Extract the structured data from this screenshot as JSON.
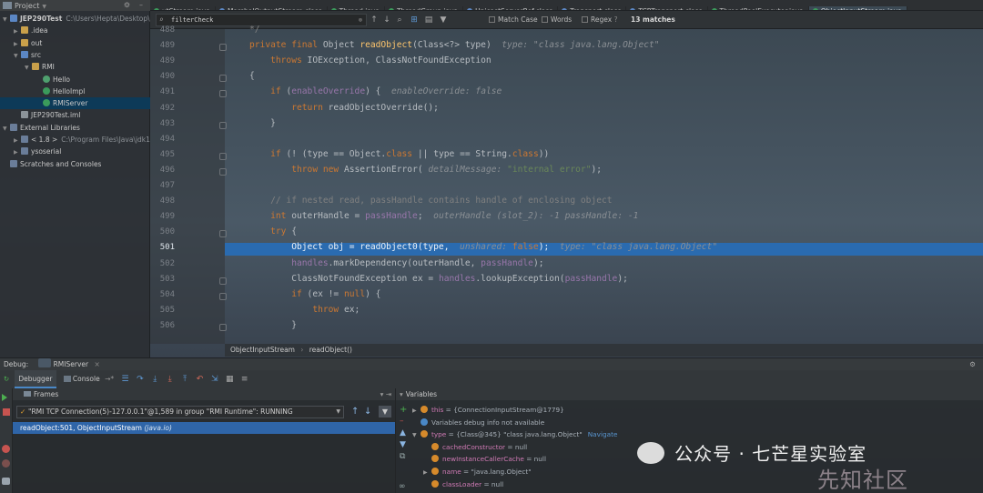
{
  "project": {
    "header": "Project",
    "tree": [
      {
        "label": "JEP290Test",
        "extra": "C:\\Users\\Hepta\\Desktop\\",
        "indent": 0,
        "icon": "folder-blue",
        "arrow": "▼",
        "bold": true
      },
      {
        "label": ".idea",
        "indent": 1,
        "icon": "folder",
        "arrow": "▶"
      },
      {
        "label": "out",
        "indent": 1,
        "icon": "folder",
        "arrow": "▶"
      },
      {
        "label": "src",
        "indent": 1,
        "icon": "folder-blue",
        "arrow": "▼"
      },
      {
        "label": "RMI",
        "indent": 2,
        "icon": "folder",
        "arrow": "▼"
      },
      {
        "label": "Hello",
        "indent": 3,
        "icon": "interface"
      },
      {
        "label": "HelloImpl",
        "indent": 3,
        "icon": "class"
      },
      {
        "label": "RMIServer",
        "indent": 3,
        "icon": "class",
        "selected": true
      },
      {
        "label": "JEP290Test.iml",
        "indent": 1,
        "icon": "file"
      },
      {
        "label": "External Libraries",
        "indent": 0,
        "icon": "library",
        "arrow": "▼"
      },
      {
        "label": "< 1.8 >",
        "extra": "C:\\Program Files\\Java\\jdk1",
        "indent": 1,
        "icon": "library",
        "arrow": "▶"
      },
      {
        "label": "ysoserial",
        "indent": 1,
        "icon": "library",
        "arrow": "▶"
      },
      {
        "label": "Scratches and Consoles",
        "indent": 0,
        "icon": "library"
      }
    ]
  },
  "tabs": [
    {
      "label": "utStream.java"
    },
    {
      "label": "MarshalOutputStream.class"
    },
    {
      "label": "Thread.java"
    },
    {
      "label": "ThreadGroup.java"
    },
    {
      "label": "UnicastServerRef.class"
    },
    {
      "label": "Transport.class"
    },
    {
      "label": "TCPTransport.class"
    },
    {
      "label": "ThreadPoolExecutor.java"
    },
    {
      "label": "ObjectInputStream.java",
      "active": true
    }
  ],
  "find": {
    "query": "filterCheck",
    "match_case": "Match Case",
    "words": "Words",
    "regex": "Regex",
    "help": "?",
    "matches": "13 matches"
  },
  "code": {
    "lines": [
      {
        "n": "488",
        "html": "<span class=\"cm\">*/</span>"
      },
      {
        "n": "489",
        "html": "<span class=\"kw\">private final</span> Object <span class=\"fn\">readObject</span>(Class&lt;?&gt; type)  <span class=\"hint\">type: \"class java.lang.Object\"</span>"
      },
      {
        "n": "489",
        "html": "    <span class=\"kw\">throws</span> IOException, ClassNotFoundException"
      },
      {
        "n": "490",
        "html": "{"
      },
      {
        "n": "491",
        "html": "    <span class=\"kw\">if</span> (<span class=\"fld\">enableOverride</span>) {  <span class=\"hint\">enableOverride: false</span>"
      },
      {
        "n": "492",
        "html": "        <span class=\"kw\">return</span> readObjectOverride();"
      },
      {
        "n": "493",
        "html": "    }"
      },
      {
        "n": "494",
        "html": ""
      },
      {
        "n": "495",
        "html": "    <span class=\"kw\">if</span> (! (type == Object.<span class=\"kw\">class</span> || type == String.<span class=\"kw\">class</span>))"
      },
      {
        "n": "496",
        "html": "        <span class=\"kw\">throw new</span> AssertionError( <span class=\"hint\">detailMessage:</span> <span class=\"str\">\"internal error\"</span>);"
      },
      {
        "n": "497",
        "html": ""
      },
      {
        "n": "498",
        "html": "    <span class=\"cm\">// if nested read, passHandle contains handle of enclosing object</span>"
      },
      {
        "n": "499",
        "html": "    <span class=\"kw\">int</span> outerHandle = <span class=\"fld\">passHandle</span>;  <span class=\"hint\">outerHandle (slot_2): -1 passHandle: -1</span>"
      },
      {
        "n": "500",
        "html": "    <span class=\"kw\">try</span> {"
      },
      {
        "n": "501",
        "html": "        Object obj = readObject0(type,  <span class=\"hint\">unshared:</span> <span class=\"kw\">false</span>);  <span class=\"hint\">type: \"class java.lang.Object\"</span>",
        "hl": true
      },
      {
        "n": "502",
        "html": "        <span class=\"fld\">handles</span>.markDependency(outerHandle, <span class=\"fld\">passHandle</span>);"
      },
      {
        "n": "503",
        "html": "        ClassNotFoundException ex = <span class=\"fld\">handles</span>.lookupException(<span class=\"fld\">passHandle</span>);"
      },
      {
        "n": "504",
        "html": "        <span class=\"kw\">if</span> (ex != <span class=\"kw\">null</span>) {"
      },
      {
        "n": "505",
        "html": "            <span class=\"kw\">throw</span> ex;"
      },
      {
        "n": "506",
        "html": "        }"
      }
    ]
  },
  "breadcrumb": {
    "a": "ObjectInputStream",
    "b": "readObject()"
  },
  "debug": {
    "label": "Debug:",
    "config": "RMIServer",
    "debugger_tab": "Debugger",
    "console_tab": "Console",
    "frames_title": "Frames",
    "variables_title": "Variables",
    "thread": "\"RMI TCP Connection(5)-127.0.0.1\"@1,589 in group \"RMI Runtime\": RUNNING",
    "frame_selected": "readObject:501, ObjectInputStream",
    "frame_pkg": "(java.io)"
  },
  "variables": [
    {
      "name": "this",
      "value": "= {ConnectionInputStream@1779}",
      "icon": "orange",
      "arrow": "▶"
    },
    {
      "name": "",
      "value": "Variables debug info not available",
      "icon": "info"
    },
    {
      "name": "type",
      "value": "= {Class@345} \"class java.lang.Object\"",
      "icon": "orange",
      "arrow": "▼",
      "link": "Navigate"
    },
    {
      "name": "cachedConstructor",
      "value": "= null",
      "icon": "orange",
      "indent": true
    },
    {
      "name": "newInstanceCallerCache",
      "value": "= null",
      "icon": "orange",
      "indent": true
    },
    {
      "name": "name",
      "value": "= \"java.lang.Object\"",
      "icon": "orange",
      "indent": true,
      "arrow": "▶"
    },
    {
      "name": "classLoader",
      "value": "= null",
      "icon": "orange",
      "indent": true
    }
  ],
  "watermark": {
    "wechat": "公众号 · 七芒星实验室",
    "site": "先知社区"
  },
  "colors": {
    "accent": "#4a88c7",
    "highlight": "#2a6bb0",
    "keyword": "#cc7832",
    "string": "#6a8759"
  }
}
